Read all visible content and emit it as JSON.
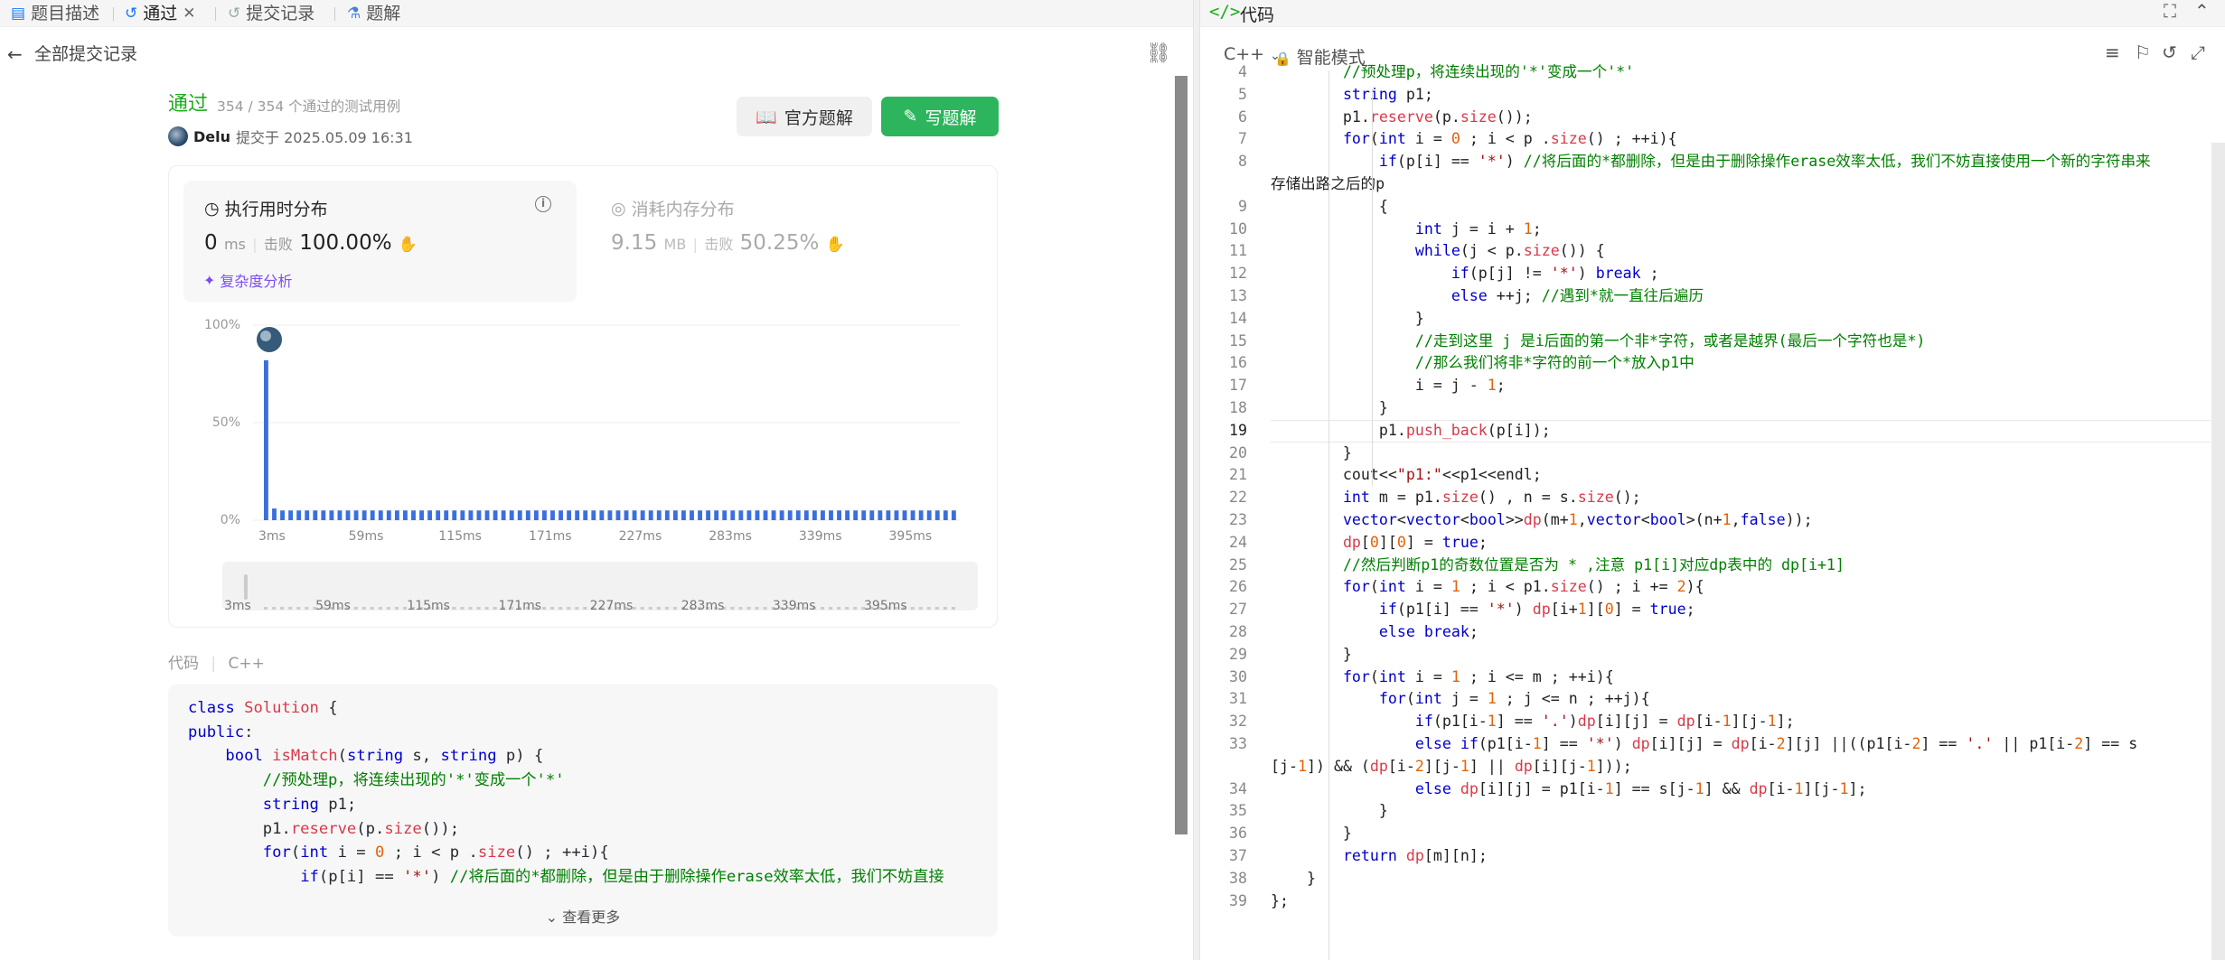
{
  "left_tabs": [
    {
      "icon": "document-icon",
      "label": "题目描述"
    },
    {
      "icon": "history-icon",
      "label": "通过"
    },
    {
      "icon": "history-icon",
      "label": "提交记录"
    },
    {
      "icon": "flask-icon",
      "label": "题解"
    }
  ],
  "close_glyph": "✕",
  "back_label": "全部提交记录",
  "status": {
    "label": "通过",
    "tests": "354 / 354 个通过的测试用例"
  },
  "user": {
    "name": "Delu",
    "submitted": "提交于 2025.05.09 16:31"
  },
  "buttons": {
    "official": "官方题解",
    "write": "写题解"
  },
  "runtime": {
    "title": "执行用时分布",
    "value": "0",
    "unit": "ms",
    "beat_label": "击败",
    "beat_pct": "100.00%"
  },
  "memory": {
    "title": "消耗内存分布",
    "value": "9.15",
    "unit": "MB",
    "beat_label": "击败",
    "beat_pct": "50.25%"
  },
  "complexity_label": "复杂度分析",
  "chart_data": {
    "type": "bar",
    "ylim": [
      0,
      100
    ],
    "y_ticks": [
      "100%",
      "50%",
      "0%"
    ],
    "x_ticks": [
      "3ms",
      "59ms",
      "115ms",
      "171ms",
      "227ms",
      "283ms",
      "339ms",
      "395ms"
    ],
    "values": [
      82,
      6,
      5,
      5,
      5,
      5,
      5,
      5,
      5,
      5,
      5,
      5,
      5,
      5,
      5,
      5,
      5,
      5,
      5,
      5,
      5,
      5,
      5,
      5,
      5,
      5,
      5,
      5,
      5,
      5,
      5,
      5,
      5,
      5,
      5,
      5,
      5,
      5,
      5,
      5,
      5,
      5,
      5,
      5,
      5,
      5,
      5,
      5,
      5,
      5,
      5,
      5,
      5,
      5,
      5,
      5,
      5,
      5,
      5,
      5,
      5,
      5,
      5,
      5,
      5,
      5,
      5,
      5,
      5,
      5,
      5,
      5,
      5,
      5,
      5,
      5,
      5,
      5,
      5,
      5,
      5,
      5,
      5,
      5,
      5
    ],
    "bar_color": "#3b6fe0",
    "grid": true
  },
  "code_section": {
    "label": "代码",
    "lang": "C++",
    "more": "查看更多"
  },
  "left_code": [
    "class Solution {",
    "public:",
    "    bool isMatch(string s, string p) {",
    "        //预处理p，将连续出现的'*'变成一个'*'",
    "        string p1;",
    "        p1.reserve(p.size());",
    "        for(int i = 0 ; i < p .size() ; ++i){",
    "            if(p[i] == '*') //将后面的*都删除，但是由于删除操作erase效率太低，我们不妨直接"
  ],
  "right_header": {
    "title": "代码",
    "lang": "C++",
    "mode": "智能模式"
  },
  "editor": {
    "current_line": "19",
    "lines": [
      {
        "n": "4",
        "code": "        //预处理p，将连续出现的'*'变成一个'*'"
      },
      {
        "n": "5",
        "code": "        string p1;"
      },
      {
        "n": "6",
        "code": "        p1.reserve(p.size());"
      },
      {
        "n": "7",
        "code": "        for(int i = 0 ; i < p .size() ; ++i){"
      },
      {
        "n": "8",
        "code": "            if(p[i] == '*') //将后面的*都删除，但是由于删除操作erase效率太低，我们不妨直接使用一个新的字符串来"
      },
      {
        "n": "",
        "code": "存储出路之后的p"
      },
      {
        "n": "9",
        "code": "            {"
      },
      {
        "n": "10",
        "code": "                int j = i + 1;"
      },
      {
        "n": "11",
        "code": "                while(j < p.size()) {"
      },
      {
        "n": "12",
        "code": "                    if(p[j] != '*') break ;"
      },
      {
        "n": "13",
        "code": "                    else ++j; //遇到*就一直往后遍历"
      },
      {
        "n": "14",
        "code": "                }"
      },
      {
        "n": "15",
        "code": "                //走到这里 j 是i后面的第一个非*字符，或者是越界(最后一个字符也是*)"
      },
      {
        "n": "16",
        "code": "                //那么我们将非*字符的前一个*放入p1中"
      },
      {
        "n": "17",
        "code": "                i = j - 1;"
      },
      {
        "n": "18",
        "code": "            }"
      },
      {
        "n": "19",
        "code": "            p1.push_back(p[i]);"
      },
      {
        "n": "20",
        "code": "        }"
      },
      {
        "n": "21",
        "code": "        cout<<\"p1:\"<<p1<<endl;"
      },
      {
        "n": "22",
        "code": "        int m = p1.size() , n = s.size();"
      },
      {
        "n": "23",
        "code": "        vector<vector<bool>>dp(m+1,vector<bool>(n+1,false));"
      },
      {
        "n": "24",
        "code": "        dp[0][0] = true;"
      },
      {
        "n": "25",
        "code": "        //然后判断p1的奇数位置是否为 * ,注意 p1[i]对应dp表中的 dp[i+1]"
      },
      {
        "n": "26",
        "code": "        for(int i = 1 ; i < p1.size() ; i += 2){"
      },
      {
        "n": "27",
        "code": "            if(p1[i] == '*') dp[i+1][0] = true;"
      },
      {
        "n": "28",
        "code": "            else break;"
      },
      {
        "n": "29",
        "code": "        }"
      },
      {
        "n": "30",
        "code": "        for(int i = 1 ; i <= m ; ++i){"
      },
      {
        "n": "31",
        "code": "            for(int j = 1 ; j <= n ; ++j){"
      },
      {
        "n": "32",
        "code": "                if(p1[i-1] == '.')dp[i][j] = dp[i-1][j-1];"
      },
      {
        "n": "33",
        "code": "                else if(p1[i-1] == '*') dp[i][j] = dp[i-2][j] ||((p1[i-2] == '.' || p1[i-2] == s"
      },
      {
        "n": "",
        "code": "[j-1]) && (dp[i-2][j-1] || dp[i][j-1]));"
      },
      {
        "n": "34",
        "code": "                else dp[i][j] = p1[i-1] == s[j-1] && dp[i-1][j-1];"
      },
      {
        "n": "35",
        "code": "            }"
      },
      {
        "n": "36",
        "code": "        }"
      },
      {
        "n": "37",
        "code": "        return dp[m][n];"
      },
      {
        "n": "38",
        "code": "    }"
      },
      {
        "n": "39",
        "code": "};"
      }
    ]
  },
  "colors": {
    "accepted": "#1aad19",
    "write_button": "#2db55d",
    "accent_purple": "#7a4df0",
    "keyword": "#0000cc",
    "comment": "#008000"
  }
}
